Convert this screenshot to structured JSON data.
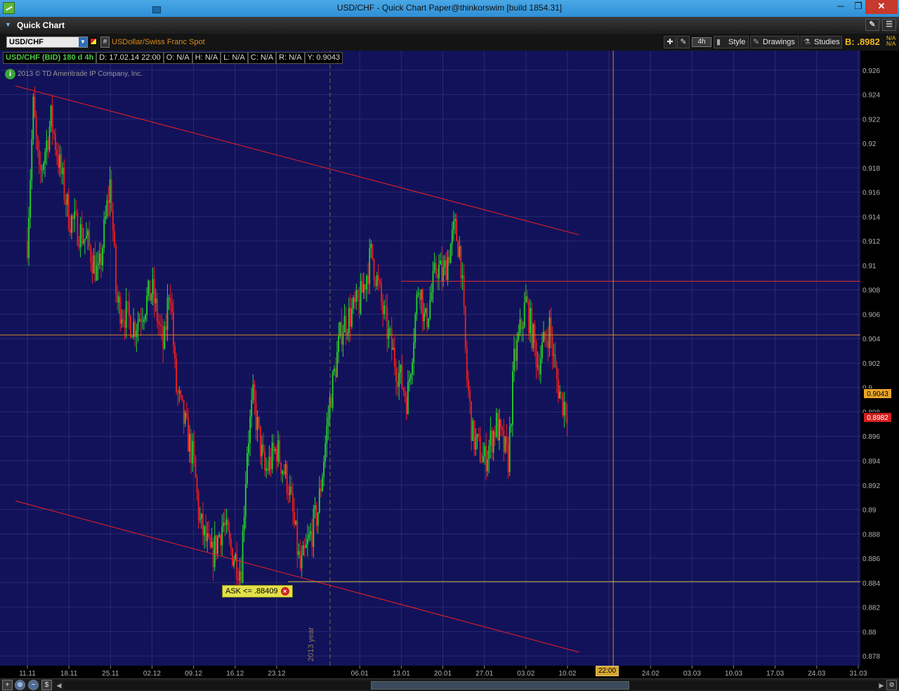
{
  "window": {
    "title": "USD/CHF - Quick Chart Paper@thinkorswim [build 1854.31]",
    "minimize_label": "─",
    "maximize_label": "❐",
    "close_label": "✕"
  },
  "header": {
    "title": "Quick Chart"
  },
  "toolbar": {
    "symbol": "USD/CHF",
    "description": "USDollar/Swiss Franc Spot",
    "aggregation": "4h",
    "style_label": "Style",
    "drawings_label": "Drawings",
    "studies_label": "Studies",
    "bid": "B: .8982",
    "na_top": "N/A",
    "na_bottom": "N/A"
  },
  "info_strip": {
    "study": "USD/CHF (BID) 180 d 4h",
    "date": "D: 17.02.14 22:00",
    "open": "O: N/A",
    "high": "H: N/A",
    "low": "L: N/A",
    "close": "C: N/A",
    "range": "R: N/A",
    "y_value": "Y: 0.9043"
  },
  "chart": {
    "copyright": "2013 © TD Ameritrade IP Company, Inc.",
    "year_marker": "2013 year",
    "current_price_tag": "0.9043",
    "last_price_tag": "0.8982",
    "ask_alert": "ASK <= .88409",
    "time_cursor": "22:00",
    "colors": {
      "background": "#12125a",
      "grid": "#2a2a74",
      "up": "#26d42a",
      "down": "#ee1f1f",
      "trendline": "#ee2020",
      "level": "#d98b1f"
    }
  },
  "chart_data": {
    "type": "candlestick",
    "title": "USD/CHF (BID) 180 d 4h",
    "y_ticks": [
      "0.926",
      "0.924",
      "0.922",
      "0.92",
      "0.918",
      "0.916",
      "0.914",
      "0.912",
      "0.91",
      "0.908",
      "0.906",
      "0.904",
      "0.902",
      "0.9",
      "0.898",
      "0.896",
      "0.894",
      "0.892",
      "0.89",
      "0.888",
      "0.886",
      "0.884",
      "0.882",
      "0.88",
      "0.878"
    ],
    "x_ticks": [
      "11.11",
      "18.11",
      "25.11",
      "02.12",
      "09.12",
      "16.12",
      "23.12",
      "06.01",
      "13.01",
      "20.01",
      "27.01",
      "03.02",
      "10.02",
      "17",
      "24.02",
      "03.03",
      "10.03",
      "17.03",
      "24.03",
      "31.03"
    ],
    "ylim": [
      0.8772,
      0.9276
    ],
    "grid": true,
    "price_path": [
      {
        "date": "11.11",
        "price": 0.912
      },
      {
        "date": "12.11",
        "price": 0.923
      },
      {
        "date": "13.11",
        "price": 0.917
      },
      {
        "date": "15.11",
        "price": 0.922
      },
      {
        "date": "18.11",
        "price": 0.914
      },
      {
        "date": "21.11",
        "price": 0.912
      },
      {
        "date": "23.11",
        "price": 0.909
      },
      {
        "date": "25.11",
        "price": 0.917
      },
      {
        "date": "26.11",
        "price": 0.907
      },
      {
        "date": "29.11",
        "price": 0.905
      },
      {
        "date": "02.12",
        "price": 0.908
      },
      {
        "date": "04.12",
        "price": 0.903
      },
      {
        "date": "05.12",
        "price": 0.909
      },
      {
        "date": "06.12",
        "price": 0.9
      },
      {
        "date": "09.12",
        "price": 0.894
      },
      {
        "date": "10.12",
        "price": 0.889
      },
      {
        "date": "12.12",
        "price": 0.886
      },
      {
        "date": "14.12",
        "price": 0.889
      },
      {
        "date": "15.12",
        "price": 0.887
      },
      {
        "date": "17.12",
        "price": 0.885
      },
      {
        "date": "18.12",
        "price": 0.895
      },
      {
        "date": "19.12",
        "price": 0.899
      },
      {
        "date": "21.12",
        "price": 0.893
      },
      {
        "date": "23.12",
        "price": 0.895
      },
      {
        "date": "25.12",
        "price": 0.892
      },
      {
        "date": "27.12",
        "price": 0.885
      },
      {
        "date": "30.12",
        "price": 0.89
      },
      {
        "date": "01.01",
        "price": 0.899
      },
      {
        "date": "03.01",
        "price": 0.905
      },
      {
        "date": "06.01",
        "price": 0.907
      },
      {
        "date": "08.01",
        "price": 0.911
      },
      {
        "date": "10.01",
        "price": 0.906
      },
      {
        "date": "12.01",
        "price": 0.902
      },
      {
        "date": "14.01",
        "price": 0.899
      },
      {
        "date": "16.01",
        "price": 0.909
      },
      {
        "date": "17.01",
        "price": 0.905
      },
      {
        "date": "19.01",
        "price": 0.91
      },
      {
        "date": "20.01",
        "price": 0.909
      },
      {
        "date": "22.01",
        "price": 0.913
      },
      {
        "date": "23.01",
        "price": 0.911
      },
      {
        "date": "24.01",
        "price": 0.901
      },
      {
        "date": "25.01",
        "price": 0.896
      },
      {
        "date": "27.01",
        "price": 0.894
      },
      {
        "date": "29.01",
        "price": 0.897
      },
      {
        "date": "31.01",
        "price": 0.894
      },
      {
        "date": "01.02",
        "price": 0.902
      },
      {
        "date": "03.02",
        "price": 0.907
      },
      {
        "date": "05.02",
        "price": 0.902
      },
      {
        "date": "07.02",
        "price": 0.905
      },
      {
        "date": "08.02",
        "price": 0.901
      },
      {
        "date": "09.02",
        "price": 0.899
      },
      {
        "date": "10.02",
        "price": 0.8982
      }
    ],
    "trendlines": [
      {
        "name": "upper resistance",
        "from": {
          "date": "09.11",
          "price": 0.9247
        },
        "to": {
          "date": "12.02",
          "price": 0.9125
        }
      },
      {
        "name": "lower support",
        "from": {
          "date": "09.11",
          "price": 0.8907
        },
        "to": {
          "date": "12.02",
          "price": 0.8783
        }
      }
    ],
    "levels": [
      {
        "name": "horizontal line",
        "price": 0.9087
      },
      {
        "name": "cursor y",
        "price": 0.9043
      },
      {
        "name": "ask alert",
        "price": 0.88409
      }
    ]
  },
  "bottombar": {
    "tool1": "+",
    "tool2": "⊕",
    "tool3": "−",
    "tool4": "$",
    "left_arrow": "◀",
    "right_arrow": "▶",
    "settings": "⚙"
  }
}
